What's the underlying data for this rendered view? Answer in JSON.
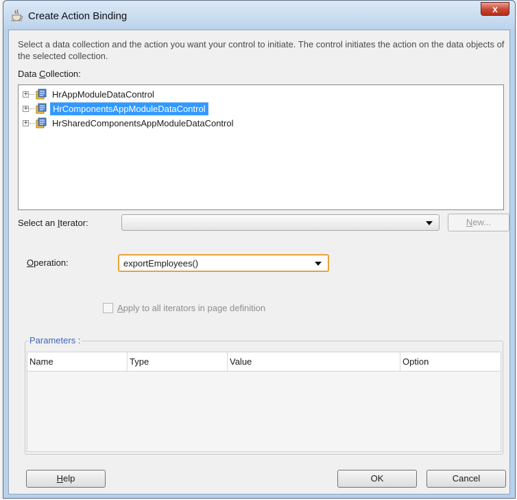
{
  "window": {
    "title": "Create Action Binding",
    "close_glyph": "x"
  },
  "description": "Select a data collection and the action you want your control to initiate. The control initiates the action on the data objects of the selected collection.",
  "data_collection": {
    "label_pre": "Data ",
    "label_mnemonic": "C",
    "label_post": "ollection:",
    "items": [
      {
        "label": "HrAppModuleDataControl",
        "selected": false
      },
      {
        "label": "HrComponentsAppModuleDataControl",
        "selected": true
      },
      {
        "label": "HrSharedComponentsAppModuleDataControl",
        "selected": false
      }
    ]
  },
  "iterator": {
    "label_pre": "Select an ",
    "label_mnemonic": "I",
    "label_post": "terator:",
    "value": "",
    "new_button_mnemonic": "N",
    "new_button_post": "ew..."
  },
  "operation": {
    "label_mnemonic": "O",
    "label_post": "peration:",
    "value": "exportEmployees()"
  },
  "apply_all": {
    "label_mnemonic": "A",
    "label_post": "pply to all iterators in page definition",
    "checked": false
  },
  "parameters": {
    "title": "Parameters :",
    "columns": [
      "Name",
      "Type",
      "Value",
      "Option"
    ],
    "rows": []
  },
  "buttons": {
    "help_mnemonic": "H",
    "help_post": "elp",
    "ok": "OK",
    "cancel": "Cancel"
  }
}
